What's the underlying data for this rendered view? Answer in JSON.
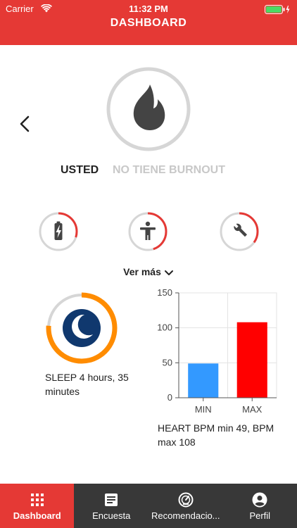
{
  "status_bar": {
    "carrier": "Carrier",
    "time": "11:32 PM"
  },
  "header": {
    "title": "DASHBOARD"
  },
  "hero": {
    "usted": "USTED",
    "status": "NO TIENE BURNOUT",
    "icon": "flame-icon"
  },
  "metrics": [
    {
      "name": "battery",
      "icon": "battery-icon",
      "progress": 0.3
    },
    {
      "name": "body",
      "icon": "person-icon",
      "progress": 0.45
    },
    {
      "name": "tools",
      "icon": "wrench-icon",
      "progress": 0.35
    }
  ],
  "ver_mas": "Ver más",
  "sleep": {
    "label": "SLEEP 4 hours, 35 minutes",
    "progress": 0.76,
    "icon": "moon-icon"
  },
  "chart_data": {
    "type": "bar",
    "categories": [
      "MIN",
      "MAX"
    ],
    "values": [
      49,
      108
    ],
    "colors": [
      "#3399ff",
      "#ff0000"
    ],
    "ylim": [
      0,
      150
    ],
    "yticks": [
      0,
      50,
      100,
      150
    ],
    "title": "",
    "xlabel": "",
    "ylabel": ""
  },
  "chart_caption": "HEART BPM min 49, BPM max 108",
  "tabs": [
    {
      "label": "Dashboard",
      "icon": "grid-icon",
      "active": true
    },
    {
      "label": "Encuesta",
      "icon": "document-icon",
      "active": false
    },
    {
      "label": "Recomendacio...",
      "icon": "gauge-icon",
      "active": false
    },
    {
      "label": "Perfil",
      "icon": "profile-icon",
      "active": false
    }
  ],
  "colors": {
    "accent": "#e53935",
    "tabbar": "#383838",
    "sleep_ring": "#ff8c00",
    "ring_track": "#d6d6d6"
  }
}
